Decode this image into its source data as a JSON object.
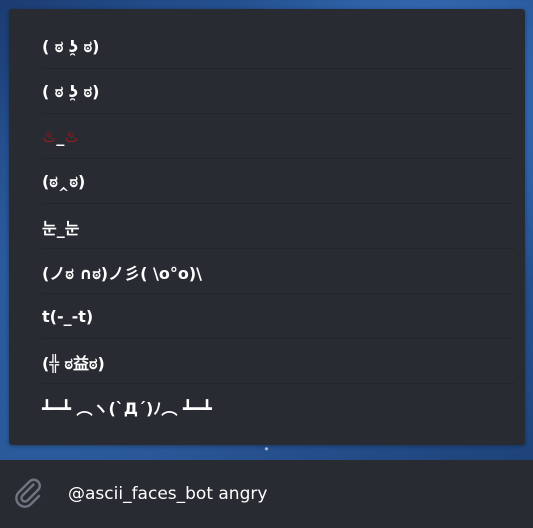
{
  "inline_results": {
    "items": [
      {
        "text": "( ಠ ʖ̯ ಠ)"
      },
      {
        "text": "( ಠ ʖ̯ ಠ)"
      },
      {
        "text_hot_left": "♨",
        "text_mid": "_",
        "text_hot_right": "♨"
      },
      {
        "text": "(ಠ‸ಠ)"
      },
      {
        "text": "눈_눈"
      },
      {
        "text": "(ノಠ ∩ಠ)ノ彡( \\o°o)\\"
      },
      {
        "text": "t(-_-t)"
      },
      {
        "text": "(╬ ಠ益ಠ)"
      },
      {
        "text": "┻━┻ ︵ヽ(`Д´)ﾉ︵ ┻━┻"
      }
    ]
  },
  "composer": {
    "input_value": "@ascii_faces_bot angry",
    "attach_icon": "paperclip-icon"
  },
  "colors": {
    "panel_bg": "#282b31",
    "text": "#ffffff",
    "hot_springs": "#c4161c"
  }
}
